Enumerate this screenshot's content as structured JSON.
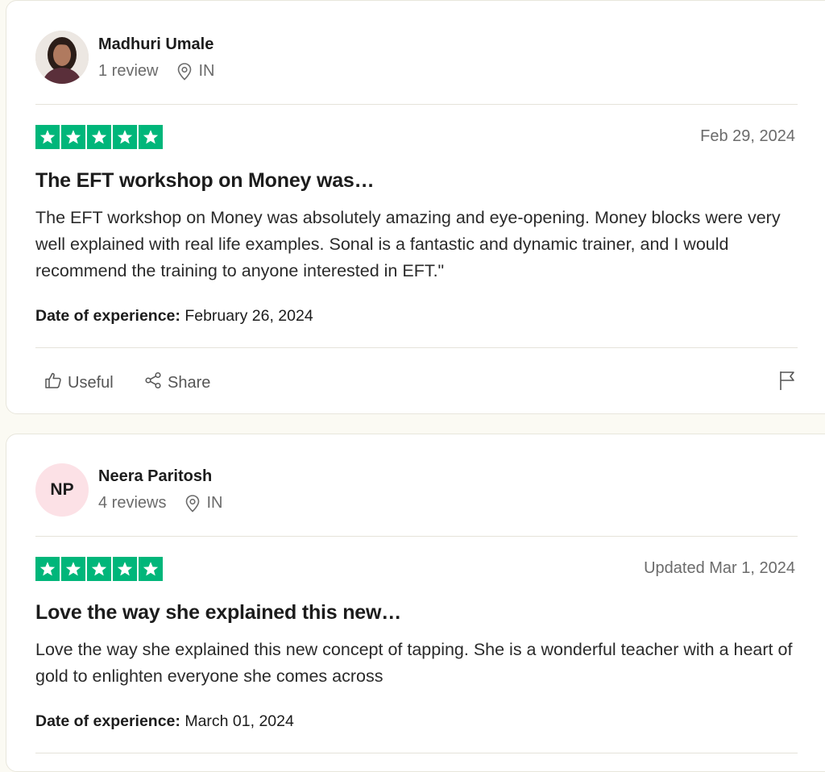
{
  "reviews": [
    {
      "reviewer_name": "Madhuri Umale",
      "review_count": "1 review",
      "country": "IN",
      "avatar": "photo",
      "rating": 5,
      "date": "Feb 29, 2024",
      "title": "The EFT workshop on Money was…",
      "body": "The EFT workshop on Money was absolutely amazing and eye-opening. Money blocks were very well explained with real life examples. Sonal is a fantastic and dynamic trainer, and I would recommend the training to anyone interested in EFT.\"",
      "experience_label": "Date of experience:",
      "experience_date": "February 26, 2024",
      "useful_label": "Useful",
      "share_label": "Share"
    },
    {
      "reviewer_name": "Neera Paritosh",
      "initials": "NP",
      "review_count": "4 reviews",
      "country": "IN",
      "rating": 5,
      "date": "Updated Mar 1, 2024",
      "title": "Love the way she explained this new…",
      "body": "Love the way she explained this new concept of tapping. She is a wonderful teacher with a heart of gold to enlighten everyone she comes across",
      "experience_label": "Date of experience:",
      "experience_date": "March 01, 2024"
    }
  ],
  "colors": {
    "star_green": "#00b67a",
    "avatar_pink": "#fce1e6",
    "page_bg": "#fbfaf3"
  },
  "icons": [
    "location-pin-icon",
    "star-icon",
    "thumbs-up-icon",
    "share-icon",
    "flag-icon"
  ]
}
